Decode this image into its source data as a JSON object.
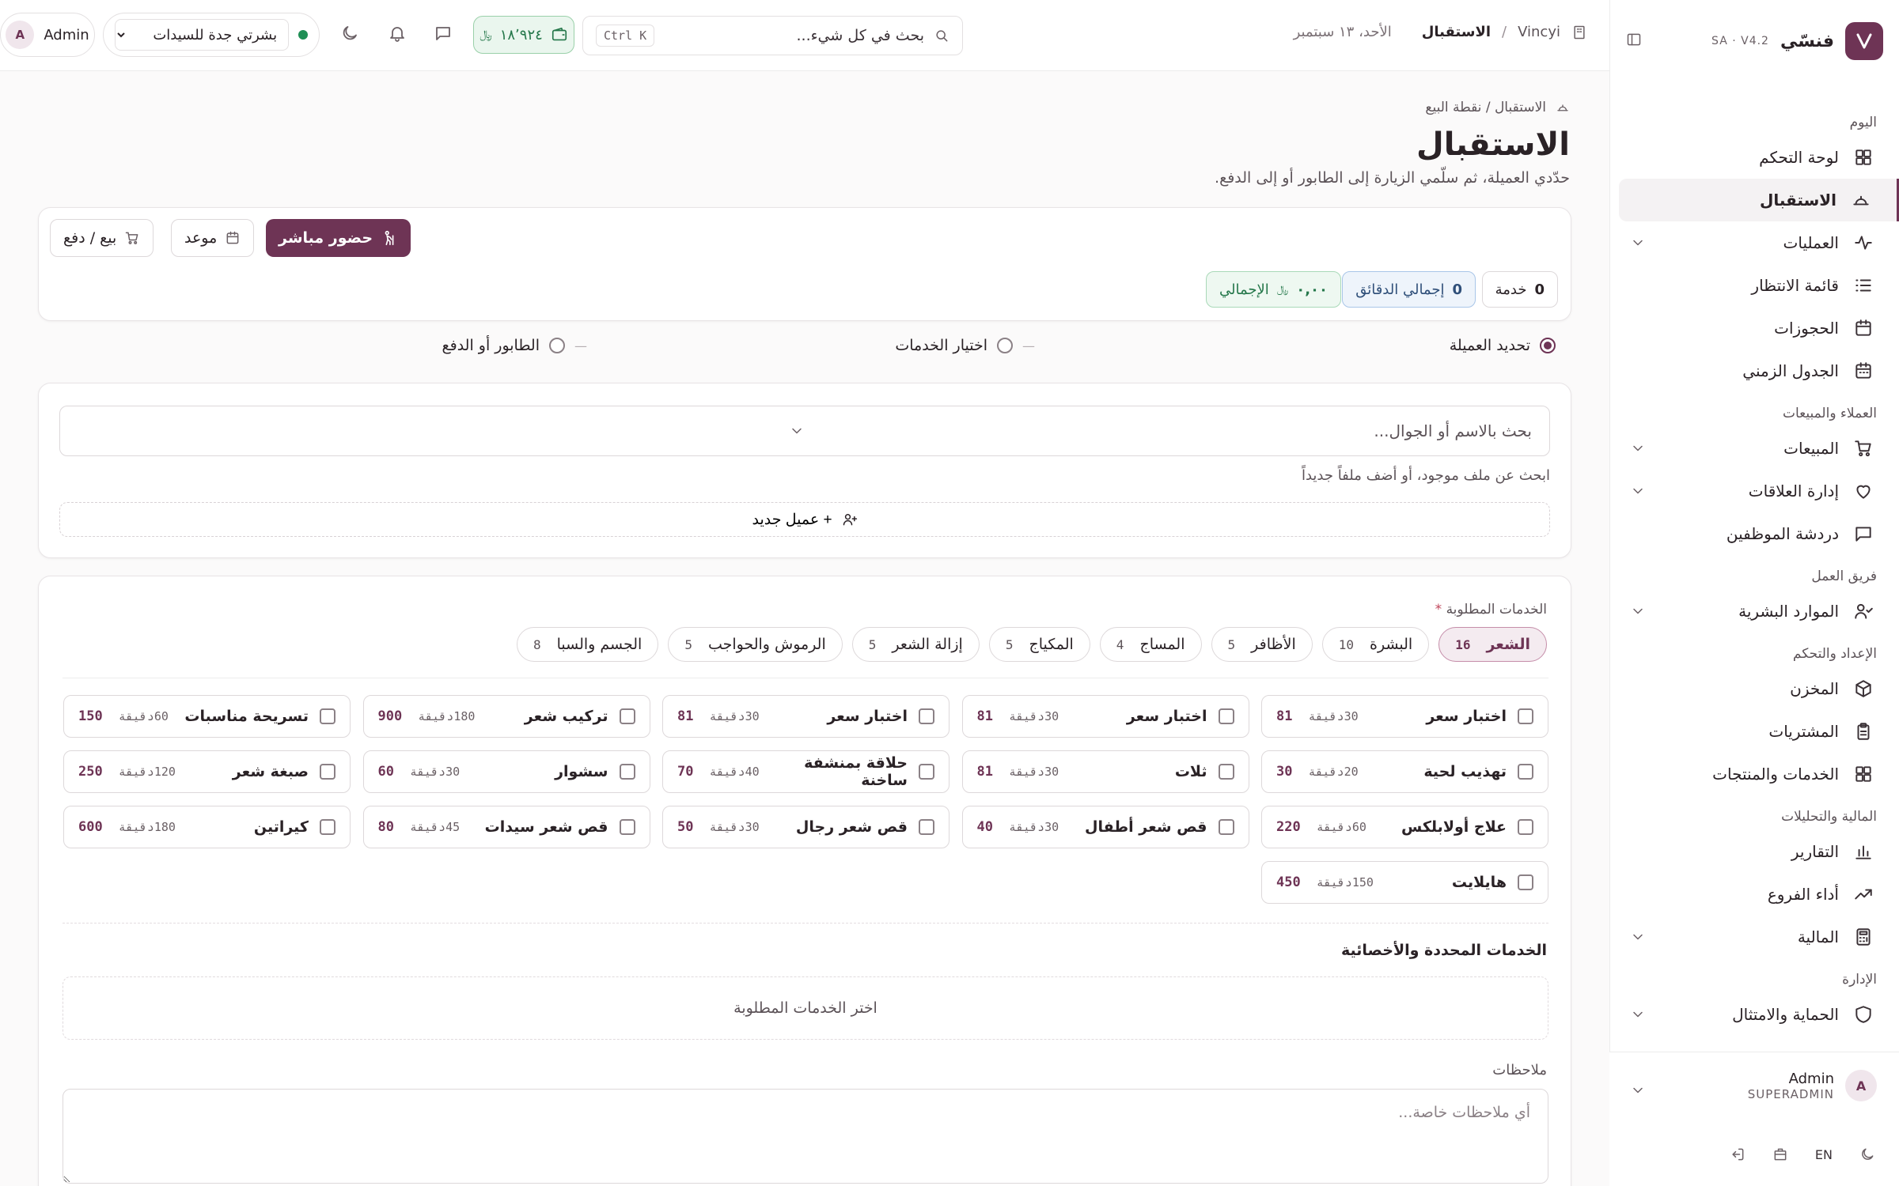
{
  "sidebar": {
    "brand_name": "فنسّي",
    "version": "SA · V4.2",
    "groups": [
      {
        "title": "اليوم",
        "items": [
          {
            "label": "لوحة التحكم",
            "icon": "dashboard-icon",
            "chevron": false,
            "active": false
          },
          {
            "label": "الاستقبال",
            "icon": "reception-bell-icon",
            "chevron": false,
            "active": true
          },
          {
            "label": "العمليات",
            "icon": "activity-icon",
            "chevron": true,
            "active": false
          },
          {
            "label": "قائمة الانتظار",
            "icon": "list-queue-icon",
            "chevron": false,
            "active": false
          },
          {
            "label": "الحجوزات",
            "icon": "calendar-icon",
            "chevron": false,
            "active": false
          },
          {
            "label": "الجدول الزمني",
            "icon": "calendar-grid-icon",
            "chevron": false,
            "active": false
          }
        ]
      },
      {
        "title": "العملاء والمبيعات",
        "items": [
          {
            "label": "المبيعات",
            "icon": "cart-icon",
            "chevron": true,
            "active": false
          },
          {
            "label": "إدارة العلاقات",
            "icon": "heart-icon",
            "chevron": true,
            "active": false
          },
          {
            "label": "دردشة الموظفين",
            "icon": "chat-icon",
            "chevron": false,
            "active": false
          }
        ]
      },
      {
        "title": "فريق العمل",
        "items": [
          {
            "label": "الموارد البشرية",
            "icon": "user-check-icon",
            "chevron": true,
            "active": false
          }
        ]
      },
      {
        "title": "الإعداد والتحكم",
        "items": [
          {
            "label": "المخزن",
            "icon": "box-icon",
            "chevron": false,
            "active": false
          },
          {
            "label": "المشتريات",
            "icon": "clipboard-icon",
            "chevron": false,
            "active": false
          },
          {
            "label": "الخدمات والمنتجات",
            "icon": "grid-icon",
            "chevron": false,
            "active": false
          }
        ]
      },
      {
        "title": "المالية والتحليلات",
        "items": [
          {
            "label": "التقارير",
            "icon": "bar-chart-icon",
            "chevron": false,
            "active": false
          },
          {
            "label": "أداء الفروع",
            "icon": "trending-up-icon",
            "chevron": false,
            "active": false
          },
          {
            "label": "المالية",
            "icon": "calculator-icon",
            "chevron": true,
            "active": false
          }
        ]
      },
      {
        "title": "الإدارة",
        "items": [
          {
            "label": "الحماية والامتثال",
            "icon": "shield-icon",
            "chevron": true,
            "active": false
          }
        ]
      }
    ],
    "user": {
      "name": "Admin",
      "role": "SUPERADMIN",
      "initial": "A"
    },
    "lang": "EN"
  },
  "topbar": {
    "crumb_root": "Vincyi",
    "crumb_current": "الاستقبال",
    "date": "الأحد، ١٣ سبتمبر",
    "search_placeholder": "بحث في كل شيء...",
    "search_shortcut": "Ctrl K",
    "wallet_amount": "١٨٬٩٢٤",
    "branch": "بشرتي جدة للسيدات",
    "admin_name": "Admin",
    "admin_initial": "A"
  },
  "page": {
    "breadcrumb": "الاستقبال / نقطة البيع",
    "title": "الاستقبال",
    "subtitle": "حدّدي العميلة، ثم سلّمي الزيارة إلى الطابور أو إلى الدفع."
  },
  "modes": {
    "walkin": "حضور مباشر",
    "appointment": "موعد",
    "sale": "بيع / دفع"
  },
  "stats": {
    "services_count": "0",
    "services_label": "خدمة",
    "minutes_value": "0",
    "minutes_label": "إجمالي الدقائق",
    "total_value": "٠,٠٠",
    "total_label": "الإجمالي"
  },
  "steps": [
    {
      "label": "تحديد العميلة",
      "active": true
    },
    {
      "label": "اختيار الخدمات",
      "active": false
    },
    {
      "label": "الطابور أو الدفع",
      "active": false
    }
  ],
  "client": {
    "search_placeholder": "بحث بالاسم أو الجوال...",
    "hint": "ابحث عن ملف موجود، أو أضف ملفاً جديداً",
    "new_client": "+ عميل جديد"
  },
  "services": {
    "label": "الخدمات المطلوبة",
    "required_mark": "*",
    "tabs": [
      {
        "label": "الشعر",
        "count": "16",
        "active": true
      },
      {
        "label": "البشرة",
        "count": "10",
        "active": false
      },
      {
        "label": "الأظافر",
        "count": "5",
        "active": false
      },
      {
        "label": "المساج",
        "count": "4",
        "active": false
      },
      {
        "label": "المكياج",
        "count": "5",
        "active": false
      },
      {
        "label": "إزالة الشعر",
        "count": "5",
        "active": false
      },
      {
        "label": "الرموش والحواجب",
        "count": "5",
        "active": false
      },
      {
        "label": "الجسم والسبا",
        "count": "8",
        "active": false
      }
    ],
    "items": [
      {
        "name": "اختبار سعر",
        "duration": "30دقيقة",
        "price": "81"
      },
      {
        "name": "اختبار سعر",
        "duration": "30دقيقة",
        "price": "81"
      },
      {
        "name": "اختبار سعر",
        "duration": "30دقيقة",
        "price": "81"
      },
      {
        "name": "تركيب شعر",
        "duration": "180دقيقة",
        "price": "900"
      },
      {
        "name": "تسريحة مناسبات",
        "duration": "60دقيقة",
        "price": "150"
      },
      {
        "name": "تهذيب لحية",
        "duration": "20دقيقة",
        "price": "30"
      },
      {
        "name": "ثلات",
        "duration": "30دقيقة",
        "price": "81"
      },
      {
        "name": "حلاقة بمنشفة ساخنة",
        "duration": "40دقيقة",
        "price": "70"
      },
      {
        "name": "سشوار",
        "duration": "30دقيقة",
        "price": "60"
      },
      {
        "name": "صبغة شعر",
        "duration": "120دقيقة",
        "price": "250"
      },
      {
        "name": "علاج أولابلكس",
        "duration": "60دقيقة",
        "price": "220"
      },
      {
        "name": "قص شعر أطفال",
        "duration": "30دقيقة",
        "price": "40"
      },
      {
        "name": "قص شعر رجال",
        "duration": "30دقيقة",
        "price": "50"
      },
      {
        "name": "قص شعر سيدات",
        "duration": "45دقيقة",
        "price": "80"
      },
      {
        "name": "كيراتين",
        "duration": "180دقيقة",
        "price": "600"
      },
      {
        "name": "هايلايت",
        "duration": "150دقيقة",
        "price": "450"
      }
    ],
    "selected_title": "الخدمات المحددة والأخصائية",
    "selected_empty": "اختر الخدمات المطلوبة",
    "notes_label": "ملاحظات",
    "notes_placeholder": "أي ملاحظات خاصة..."
  },
  "colors": {
    "accent": "#6e3455",
    "success": "#24774a",
    "info": "#2f4f79"
  }
}
